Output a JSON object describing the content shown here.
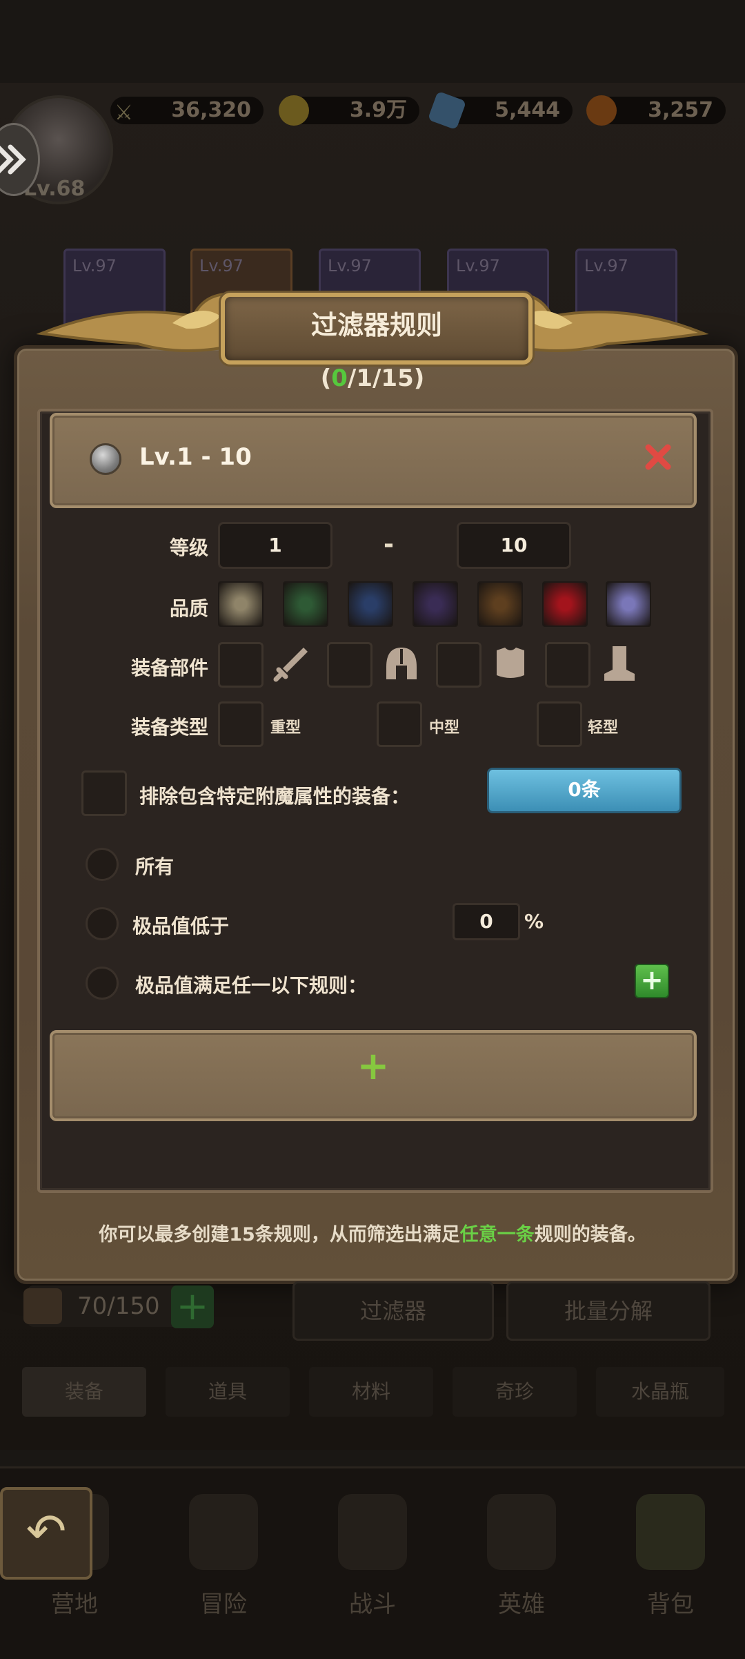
{
  "top_bar": {
    "player_level": "Lv.68",
    "power": "36,320",
    "gold": "3.9万",
    "gems": "5,444",
    "orbs": "3,257"
  },
  "hero_cards": [
    "Lv.97",
    "Lv.97",
    "Lv.97",
    "Lv.97",
    "Lv.97"
  ],
  "modal": {
    "title": "过滤器规则",
    "counter": {
      "open": "(",
      "current": "0",
      "rest": "/1/15)"
    },
    "rule": {
      "title": "Lv.1 - 10",
      "level_label": "等级",
      "level_min": "1",
      "level_dash": "-",
      "level_max": "10",
      "quality_label": "品质",
      "quality_colors": [
        "#8f8469",
        "#2e5a35",
        "#2a3e68",
        "#3a2c55",
        "#5e3f1f",
        "#a3141c",
        "#7a77b8"
      ],
      "slot_label": "装备部件",
      "slot_icons": [
        "sword-icon",
        "helmet-icon",
        "armor-icon",
        "boot-icon"
      ],
      "type_label": "装备类型",
      "types": [
        "重型",
        "中型",
        "轻型"
      ],
      "exclude_label": "排除包含特定附魔属性的装备：",
      "enchant_button": "0条",
      "options": {
        "all": "所有",
        "below": "极品值低于",
        "below_value": "0",
        "percent": "%",
        "match_any": "极品值满足任一以下规则："
      }
    },
    "footer": {
      "pre": "你可以最多创建15条规则，从而筛选出满足",
      "highlight": "任意一条",
      "post": "规则的装备。"
    }
  },
  "bag": {
    "count": "70/150",
    "filter_button": "过滤器",
    "dismantle_button": "批量分解"
  },
  "category_tabs": [
    "装备",
    "道具",
    "材料",
    "奇珍",
    "水晶瓶"
  ],
  "bottom_nav": [
    "营地",
    "冒险",
    "战斗",
    "英雄",
    "背包"
  ],
  "colors": {
    "accent_green": "#56c83d",
    "button_blue": "#4aa3c9",
    "close_red": "#e04a43"
  }
}
